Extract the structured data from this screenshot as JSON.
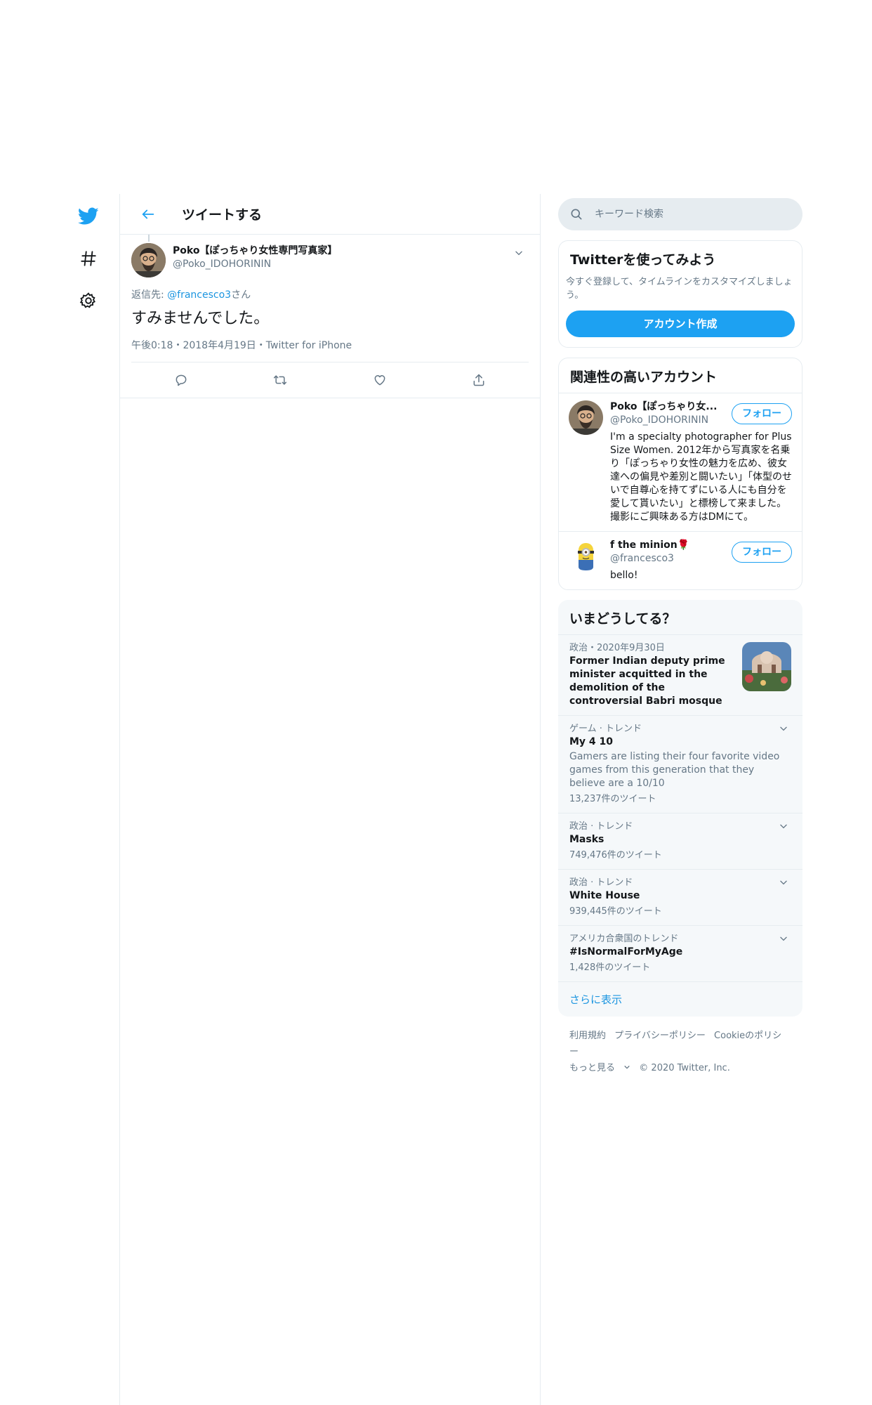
{
  "nav": {
    "items": [
      {
        "icon": "twitter-bird-icon"
      },
      {
        "icon": "hashtag-icon"
      },
      {
        "icon": "gear-icon"
      }
    ]
  },
  "header": {
    "title": "ツイートする"
  },
  "tweet": {
    "display_name": "Poko【ぽっちゃり女性専門写真家】",
    "handle": "@Poko_IDOHORININ",
    "reply_prefix": "返信先: ",
    "reply_handle": "@francesco3",
    "reply_suffix": "さん",
    "text": "すみませんでした。",
    "meta": "午後0:18・2018年4月19日・Twitter for iPhone"
  },
  "search": {
    "placeholder": "キーワード検索"
  },
  "signup": {
    "title": "Twitterを使ってみよう",
    "description": "今すぐ登録して、タイムラインをカスタマイズしましょう。",
    "button_label": "アカウント作成"
  },
  "who_to_follow": {
    "title": "関連性の高いアカウント",
    "follow_label": "フォロー",
    "accounts": [
      {
        "name": "Poko【ぽっちゃり女...",
        "handle": "@Poko_IDOHORININ",
        "bio": "I'm a specialty photographer for Plus Size Women. 2012年から写真家を名乗り「ぽっちゃり女性の魅力を広め、彼女達への偏見や差別と闘いたい」「体型のせいで自尊心を持てずにいる人にも自分を愛して貰いたい」と標榜して来ました。 撮影にご興味ある方はDMにて。"
      },
      {
        "name": "f the minion🌹",
        "handle": "@francesco3",
        "bio": "bello!"
      }
    ]
  },
  "trends": {
    "title": "いまどうしてる？",
    "news": {
      "context": "政治・2020年9月30日",
      "headline": "Former Indian deputy prime minister acquitted in the demolition of the controversial Babri mosque"
    },
    "items": [
      {
        "context": "ゲーム · トレンド",
        "name": "My 4 10",
        "description": "Gamers are listing their four favorite video games from this generation that they believe are a 10/10",
        "count": "13,237件のツイート"
      },
      {
        "context": "政治 · トレンド",
        "name": "Masks",
        "description": "",
        "count": "749,476件のツイート"
      },
      {
        "context": "政治 · トレンド",
        "name": "White House",
        "description": "",
        "count": "939,445件のツイート"
      },
      {
        "context": "アメリカ合衆国のトレンド",
        "name": "#IsNormalForMyAge",
        "description": "",
        "count": "1,428件のツイート"
      }
    ],
    "show_more": "さらに表示"
  },
  "footer": {
    "terms": "利用規約",
    "privacy": "プライバシーポリシー",
    "cookies": "Cookieのポリシー",
    "more": "もっと見る",
    "copyright": "© 2020 Twitter, Inc."
  },
  "colors": {
    "accent": "#1da1f2",
    "link": "#1b95e0",
    "muted": "#657786",
    "border": "#e6ecf0"
  }
}
